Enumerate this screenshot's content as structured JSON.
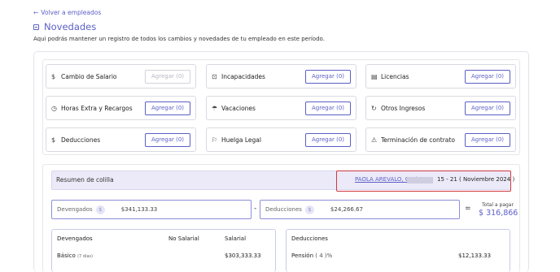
{
  "back_link": {
    "arrow": "←",
    "label": "Volver a empleados"
  },
  "page_title": "Novedades",
  "page_subtitle": "Aqui podrás mantener un registro de todos los cambios y novedades de tu empleado en este período.",
  "novedades": [
    {
      "label": "Cambio de Salario",
      "icon": "money-circle-icon",
      "glyph": "$",
      "button": "Agregar (0)",
      "disabled": true
    },
    {
      "label": "Incapacidades",
      "icon": "medkit-icon",
      "glyph": "⊡",
      "button": "Agregar (0)",
      "disabled": false
    },
    {
      "label": "Licencias",
      "icon": "document-icon",
      "glyph": "▤",
      "button": "Agregar (0)",
      "disabled": false
    },
    {
      "label": "Horas Extra y Recargos",
      "icon": "clock-icon",
      "glyph": "◷",
      "button": "Agregar (0)",
      "disabled": false
    },
    {
      "label": "Vacaciones",
      "icon": "umbrella-icon",
      "glyph": "☂",
      "button": "Agregar (0)",
      "disabled": false
    },
    {
      "label": "Otros Ingresos",
      "icon": "refresh-icon",
      "glyph": "↻",
      "button": "Agregar (0)",
      "disabled": false
    },
    {
      "label": "Deducciones",
      "icon": "deduction-icon",
      "glyph": "$",
      "button": "Agregar (0)",
      "disabled": false
    },
    {
      "label": "Huelga Legal",
      "icon": "flag-icon",
      "glyph": "⚐",
      "button": "Agregar (0)",
      "disabled": false
    },
    {
      "label": "Terminación de contrato",
      "icon": "warning-icon",
      "glyph": "⚠",
      "button": "Agregar (0)",
      "disabled": false
    }
  ],
  "summary": {
    "label": "Resumen de colilla",
    "employee_link": "PAOLA AREVALO, CC (",
    "period": "15 - 21 ( Noviembre 2024 )"
  },
  "totals": {
    "devengados_label": "Devengados",
    "devengados_value": "$341,133.33",
    "minus": "-",
    "deducciones_label": "Deducciones",
    "deducciones_value": "$24,266.67",
    "equals": "=",
    "total_label": "Total a pagar",
    "total_value": "$ 316,866",
    "currency_glyph": "$"
  },
  "devengados_table": {
    "headers": [
      "Devengados",
      "No Salarial",
      "Salarial"
    ],
    "row_label": "Básico",
    "row_note": "(7 días)",
    "row_value": "$303,333.33"
  },
  "deducciones_table": {
    "header": "Deducciones",
    "row_label": "Pensión",
    "row_note": "( 4 )%",
    "row_value": "$12,133.33"
  },
  "colors": {
    "accent": "#5b5fc7",
    "highlight_border": "#d0383f",
    "summary_bg": "#eceaf8"
  }
}
